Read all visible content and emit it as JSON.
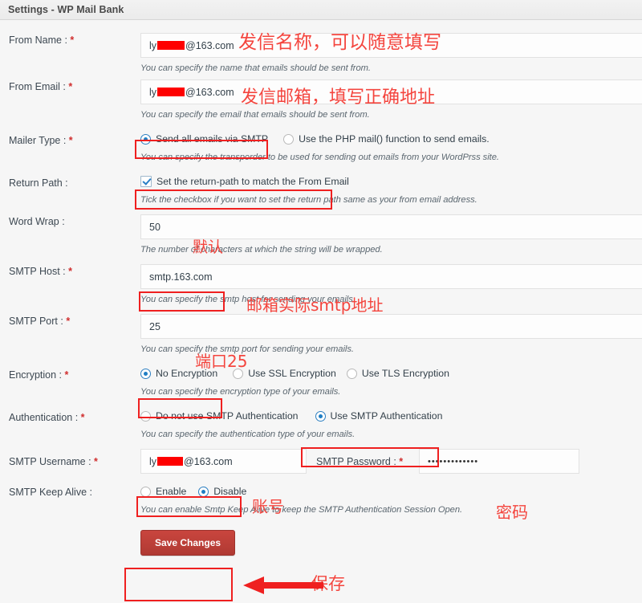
{
  "window": {
    "title": "Settings - WP Mail Bank"
  },
  "colors": {
    "annotation_red": "#f4453e",
    "highlight_box": "#ef2020",
    "save_button": "#b03a33",
    "radio_checked": "#1f7ec4",
    "required_star": "#d02e2e"
  },
  "form": {
    "rows": [
      {
        "label": "From Name :",
        "required": true,
        "type": "text",
        "value_prefix": "ly",
        "value_suffix": "@163.com",
        "redacted": true,
        "help": "You can specify the name that emails should be sent from.",
        "annotation": "发信名称，可以随意填写"
      },
      {
        "label": "From Email :",
        "required": true,
        "type": "text",
        "value_prefix": "ly",
        "value_suffix": "@163.com",
        "redacted": true,
        "help": "You can specify the email that emails should be sent from.",
        "annotation": "发信邮箱，填写正确地址"
      },
      {
        "label": "Mailer Type :",
        "required": true,
        "type": "radio",
        "options": [
          {
            "label": "Send all emails via SMTP",
            "checked": true,
            "highlighted": true
          },
          {
            "label": "Use the PHP mail() function to send emails.",
            "checked": false,
            "highlighted": false
          }
        ],
        "help": "You can specify the transporder to be used for sending out emails from your WordPrss site."
      },
      {
        "label": "Return Path :",
        "required": false,
        "type": "checkbox",
        "options": [
          {
            "label": "Set the return-path to match the From Email",
            "checked": true,
            "highlighted": true
          }
        ],
        "help": "Tick the checkbox if you want to set the return path same as your from email address."
      },
      {
        "label": "Word Wrap :",
        "required": false,
        "type": "text",
        "value": "50",
        "help": "The number of characters at which the string will be wrapped.",
        "annotation": "默认"
      },
      {
        "label": "SMTP Host :",
        "required": true,
        "type": "text",
        "value": "smtp.163.com",
        "help": "You can specify the smtp host for sending your emails.",
        "annotation": "邮箱实际smtp地址"
      },
      {
        "label": "SMTP Port :",
        "required": true,
        "type": "text",
        "value": "25",
        "help": "You can specify the smtp port for sending your emails.",
        "annotation": "端口25"
      },
      {
        "label": "Encryption :",
        "required": true,
        "type": "radio",
        "options": [
          {
            "label": "No Encryption",
            "checked": true,
            "highlighted": true
          },
          {
            "label": "Use SSL Encryption",
            "checked": false,
            "highlighted": false
          },
          {
            "label": "Use TLS Encryption",
            "checked": false,
            "highlighted": false
          }
        ],
        "help": "You can specify the encryption type of your emails."
      },
      {
        "label": "Authentication :",
        "required": true,
        "type": "radio",
        "options": [
          {
            "label": "Do not use SMTP Authentication",
            "checked": false,
            "highlighted": false
          },
          {
            "label": "Use SMTP Authentication",
            "checked": true,
            "highlighted": true
          }
        ],
        "help": "You can specify the authentication type of your emails."
      }
    ],
    "credentials": {
      "username_label": "SMTP Username :",
      "username_required": true,
      "username_prefix": "ly",
      "username_suffix": "@163.com",
      "username_annotation": "账号",
      "password_label": "SMTP Password :",
      "password_required": true,
      "password_value": "•••••••••••••",
      "password_annotation": "密码"
    },
    "keep_alive": {
      "label": "SMTP Keep Alive :",
      "required": false,
      "options": [
        {
          "label": "Enable",
          "checked": false
        },
        {
          "label": "Disable",
          "checked": true
        }
      ],
      "help": "You can enable Smtp Keep Alive to keep the SMTP Authentication Session Open."
    },
    "save": {
      "label": "Save Changes",
      "annotation": "保存"
    }
  }
}
